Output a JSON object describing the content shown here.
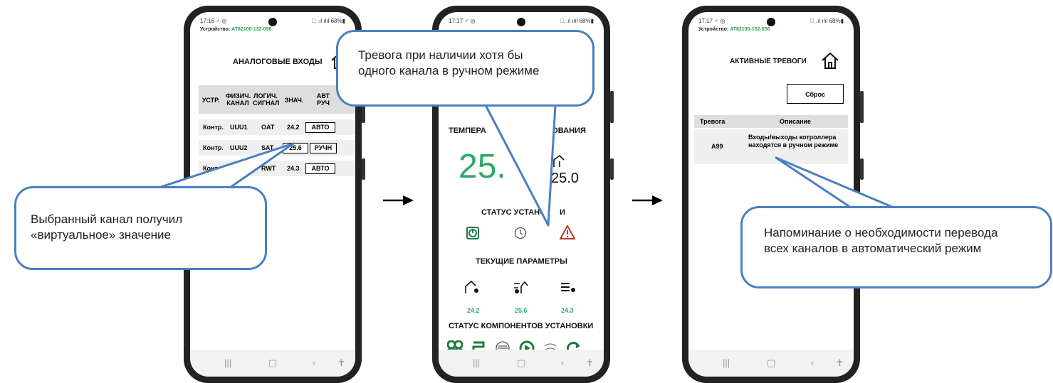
{
  "status_bar": {
    "p1_time": "17:16 ♂ ◎",
    "p2_time": "17:17 ♂ ◎",
    "p3_time": "17:17 ♂ ◎",
    "right": "⊜᷊ .ıl ılıl 68%▮"
  },
  "device_line": {
    "label": "Устройство:",
    "id": "AT82100-132-056"
  },
  "phone1": {
    "title": "АНАЛОГОВЫЕ ВХОДЫ",
    "headers": [
      "УСТР.",
      "ФИЗИЧ. КАНАЛ",
      "ЛОГИЧ. СИГНАЛ",
      "ЗНАЧ.",
      "АВТ РУЧ"
    ],
    "rows": [
      {
        "dev": "Контр.",
        "phys": "UUU1",
        "sig": "OAT",
        "val": "24.2",
        "mode": "АВТО"
      },
      {
        "dev": "Контр.",
        "phys": "UUU2",
        "sig": "SAT",
        "val": "25.6",
        "mode": "РУЧН"
      },
      {
        "dev": "Контр.",
        "phys": "UU",
        "sig": "RWT",
        "val": "24.3",
        "mode": "АВТО"
      }
    ]
  },
  "phone2": {
    "temp_title_left": "ТЕМПЕРА",
    "temp_title_right": "РОВАНИЯ",
    "big_value": "25.",
    "setpoint": "25.0",
    "status_title": "СТАТУС УСТАНО",
    "status_title_tail": "И",
    "params_title": "ТЕКУЩИЕ ПАРАМЕТРЫ",
    "params": [
      "24.2",
      "25.6",
      "24.3"
    ],
    "components_title": "СТАТУС КОМПОНЕНТОВ УСТАНОВКИ"
  },
  "phone3": {
    "title": "АКТИВНЫЕ ТРЕВОГИ",
    "reset_button": "Сброс",
    "col_alarm": "Тревога",
    "col_desc": "Описание",
    "alarm_code": "A99",
    "alarm_desc": "Входы/выходы котроллера находятся в ручном режиме"
  },
  "callouts": {
    "left": "Выбранный канал получил «виртуальное» значение",
    "top": "Тревога при наличии хотя бы одного канала в ручном режиме",
    "right": "Напоминание о необходимости перевода всех каналов в автоматический режим"
  },
  "colors": {
    "accent_green": "#2ea866",
    "callout_border": "#4a7fc1",
    "alarm_red": "#c0392b"
  }
}
